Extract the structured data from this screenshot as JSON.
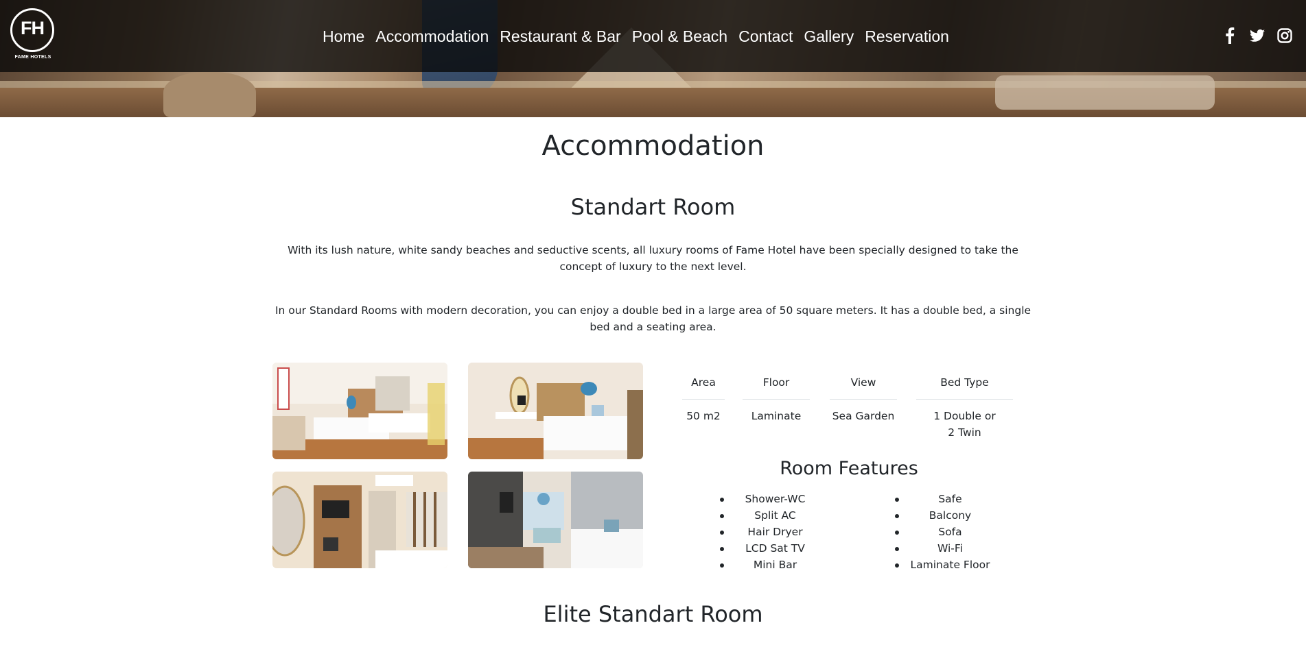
{
  "brand": {
    "logo_mark": "FH",
    "logo_text": "FAME HOTELS"
  },
  "nav": {
    "items": [
      {
        "label": "Home"
      },
      {
        "label": "Accommodation"
      },
      {
        "label": "Restaurant & Bar"
      },
      {
        "label": "Pool & Beach"
      },
      {
        "label": "Contact"
      },
      {
        "label": "Gallery"
      },
      {
        "label": "Reservation"
      }
    ]
  },
  "social": [
    "facebook-icon",
    "twitter-icon",
    "instagram-icon"
  ],
  "page": {
    "title": "Accommodation"
  },
  "room": {
    "title": "Standart Room",
    "description_1": "With its lush nature, white sandy beaches and seductive scents, all luxury rooms of Fame Hotel have been specially designed to take the concept of luxury to the next level.",
    "description_2": "In our Standard Rooms with modern decoration, you can enjoy a double bed in a large area of 50 square meters. It has a double bed, a single bed and a seating area.",
    "specs": {
      "area_label": "Area",
      "area_value": "50 m2",
      "floor_label": "Floor",
      "floor_value": "Laminate",
      "view_label": "View",
      "view_value": "Sea Garden",
      "bed_label": "Bed Type",
      "bed_value_1": "1 Double or",
      "bed_value_2": "2 Twin"
    },
    "features_title": "Room Features",
    "features_left": [
      "Shower-WC",
      "Split AC",
      "Hair Dryer",
      "LCD Sat TV",
      "Mini Bar"
    ],
    "features_right": [
      "Safe",
      "Balcony",
      "Sofa",
      "Wi-Fi",
      "Laminate Floor"
    ]
  },
  "next_room": {
    "title": "Elite Standart Room"
  }
}
